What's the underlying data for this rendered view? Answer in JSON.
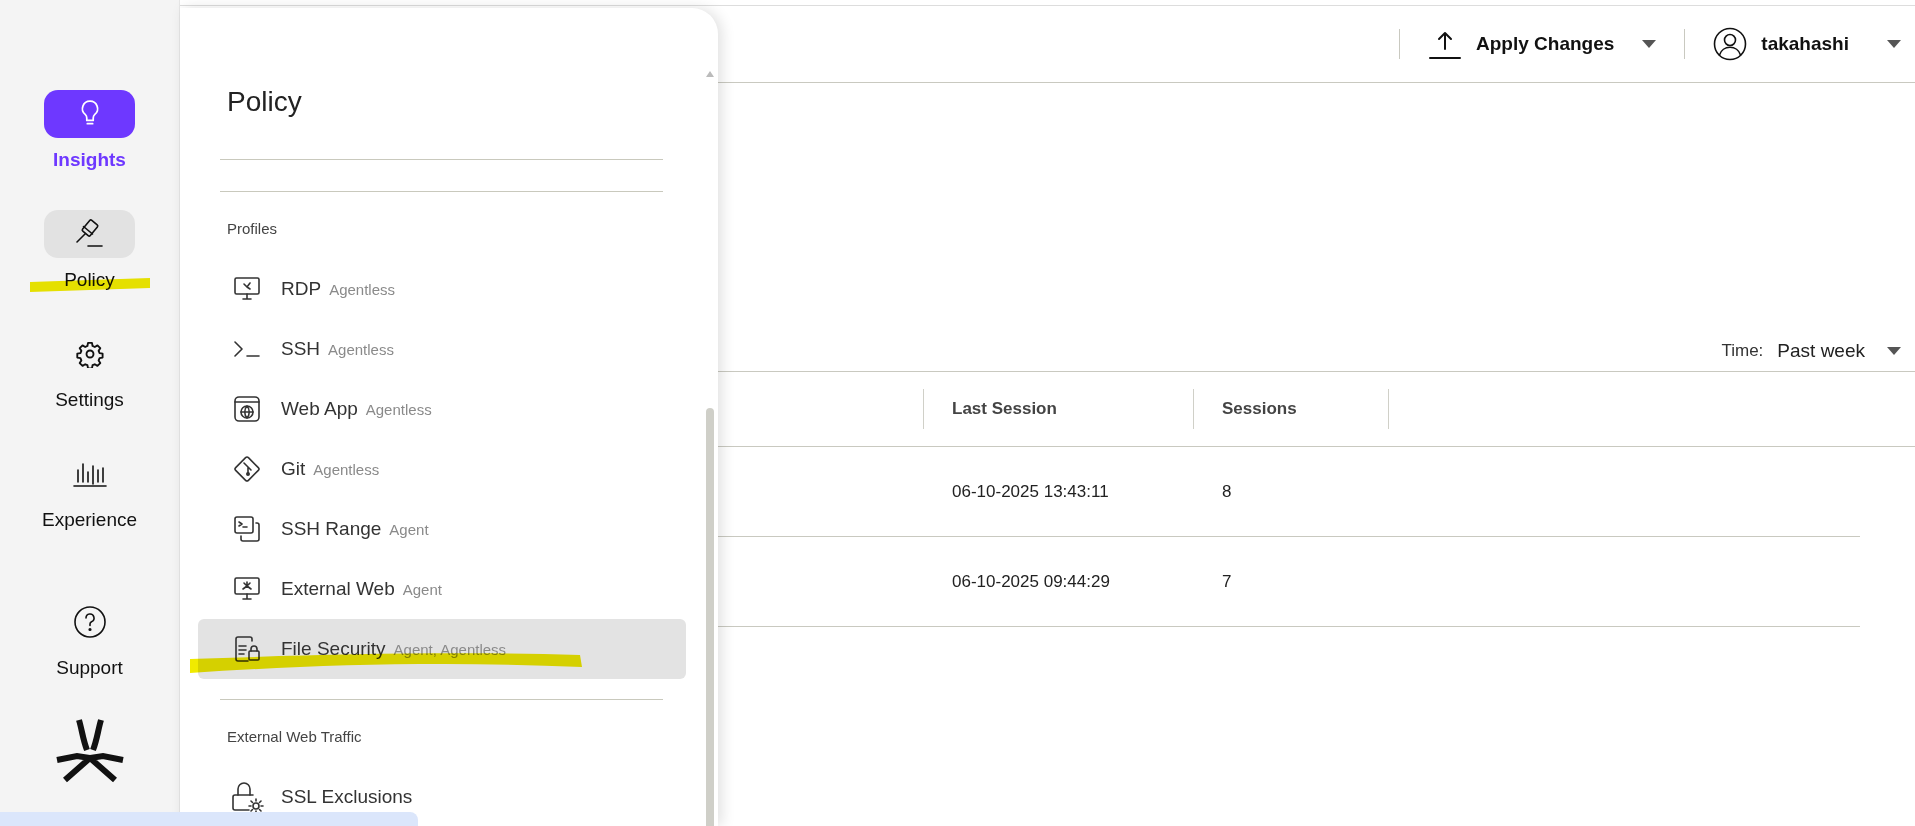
{
  "nav": {
    "items": [
      {
        "label": "Insights",
        "selected": true,
        "open": false,
        "highlighted": false
      },
      {
        "label": "Policy",
        "selected": false,
        "open": true,
        "highlighted": true
      },
      {
        "label": "Settings",
        "selected": false,
        "open": false,
        "highlighted": false
      },
      {
        "label": "Experience",
        "selected": false,
        "open": false,
        "highlighted": false
      },
      {
        "label": "Support",
        "selected": false,
        "open": false,
        "highlighted": false
      }
    ]
  },
  "top_bar": {
    "apply_button": {
      "label": "Apply Changes"
    },
    "user": {
      "name": "takahashi"
    }
  },
  "policy_menu": {
    "title": "Policy",
    "sections": [
      {
        "heading": "Profiles",
        "items": [
          {
            "label": "RDP",
            "tag": "Agentless",
            "selected": false,
            "highlighted": false
          },
          {
            "label": "SSH",
            "tag": "Agentless",
            "selected": false,
            "highlighted": false
          },
          {
            "label": "Web App",
            "tag": "Agentless",
            "selected": false,
            "highlighted": false
          },
          {
            "label": "Git",
            "tag": "Agentless",
            "selected": false,
            "highlighted": false
          },
          {
            "label": "SSH Range",
            "tag": "Agent",
            "selected": false,
            "highlighted": false
          },
          {
            "label": "External Web",
            "tag": "Agent",
            "selected": false,
            "highlighted": false
          },
          {
            "label": "File Security",
            "tag": "Agent, Agentless",
            "selected": true,
            "highlighted": true
          }
        ]
      },
      {
        "heading": "External Web Traffic",
        "items": [
          {
            "label": "SSL Exclusions",
            "selected": false,
            "highlighted": false
          }
        ]
      }
    ]
  },
  "time_filter": {
    "label": "Time:",
    "value": "Past week"
  },
  "table": {
    "columns": [
      "Last Session",
      "Sessions"
    ],
    "rows": [
      [
        "06-10-2025 13:43:11",
        "8"
      ],
      [
        "06-10-2025 09:44:29",
        "7"
      ]
    ]
  }
}
